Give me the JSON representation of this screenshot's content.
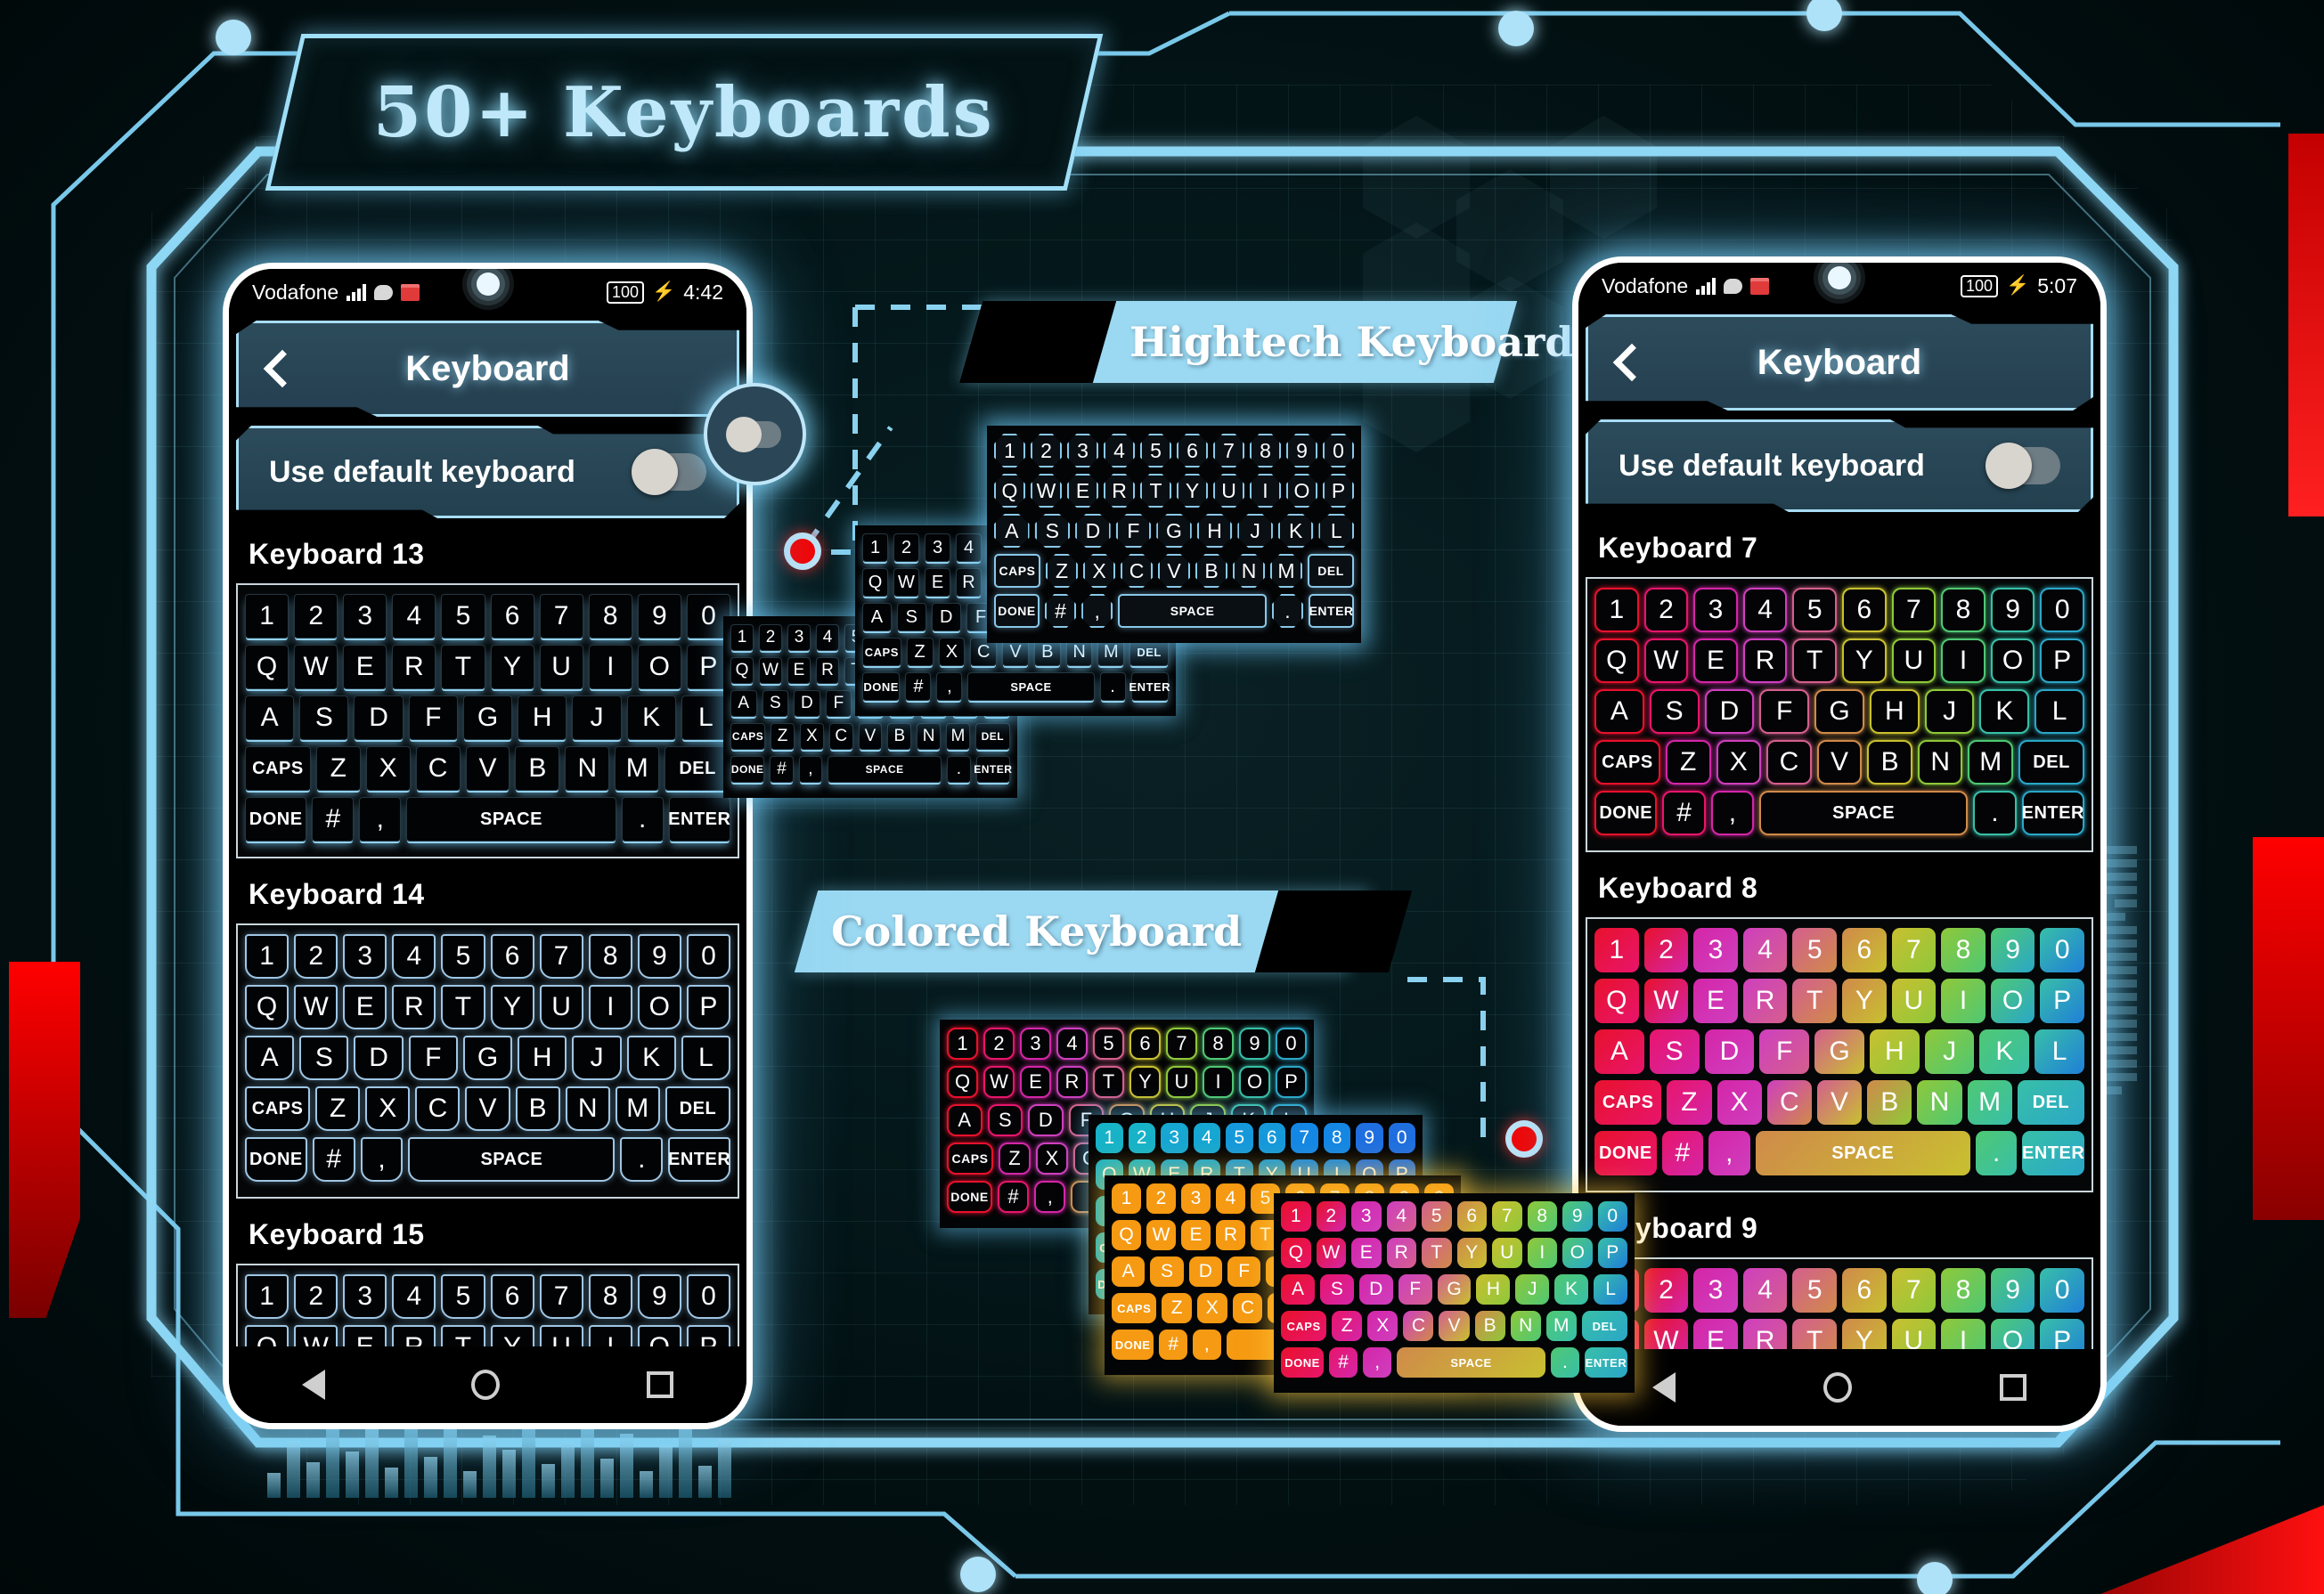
{
  "page": {
    "title": "50+ Keyboards",
    "accent": "#9bd9f2",
    "background": "#021012",
    "red_accent": "#e00000"
  },
  "banners": [
    {
      "id": "hightech",
      "label": "Hightech Keyboard"
    },
    {
      "id": "colored",
      "label": "Colored Keyboard"
    }
  ],
  "keyboard_rows": {
    "row1": [
      "1",
      "2",
      "3",
      "4",
      "5",
      "6",
      "7",
      "8",
      "9",
      "0"
    ],
    "row2": [
      "Q",
      "W",
      "E",
      "R",
      "T",
      "Y",
      "U",
      "I",
      "O",
      "P"
    ],
    "row3": [
      "A",
      "S",
      "D",
      "F",
      "G",
      "H",
      "J",
      "K",
      "L"
    ],
    "row4": [
      "CAPS",
      "Z",
      "X",
      "C",
      "V",
      "B",
      "N",
      "M",
      "DEL"
    ],
    "row5": [
      "DONE",
      "#",
      ",",
      "SPACE",
      ".",
      "ENTER"
    ]
  },
  "phone_left": {
    "status": {
      "carrier": "Vodafone",
      "signal_icon": "signal-bars-icon",
      "chat_icon": "chat-bubble-icon",
      "gift_icon": "gift-box-icon",
      "battery": "100",
      "charging_icon": "lightning-bolt-icon",
      "time": "4:42"
    },
    "header": {
      "back_icon": "back-chevron-icon",
      "title": "Keyboard"
    },
    "setting": {
      "label": "Use default keyboard",
      "toggle_state": "off"
    },
    "keyboards": [
      {
        "label": "Keyboard 13",
        "style": "black"
      },
      {
        "label": "Keyboard 14",
        "style": "outline"
      },
      {
        "label": "Keyboard 15",
        "style": "outline"
      }
    ],
    "nav": {
      "back": "nav-back-icon",
      "home": "nav-home-icon",
      "recents": "nav-recents-icon"
    }
  },
  "phone_right": {
    "status": {
      "carrier": "Vodafone",
      "signal_icon": "signal-bars-icon",
      "chat_icon": "chat-bubble-icon",
      "gift_icon": "gift-box-icon",
      "battery": "100",
      "charging_icon": "lightning-bolt-icon",
      "time": "5:07"
    },
    "header": {
      "back_icon": "back-chevron-icon",
      "title": "Keyboard"
    },
    "setting": {
      "label": "Use default keyboard",
      "toggle_state": "off"
    },
    "keyboards": [
      {
        "label": "Keyboard 7",
        "style": "rainbow-outline"
      },
      {
        "label": "Keyboard 8",
        "style": "rainbow-fill"
      },
      {
        "label": "Keyboard 9",
        "style": "rainbow-fill"
      }
    ],
    "nav": {
      "back": "nav-back-icon",
      "home": "nav-home-icon",
      "recents": "nav-recents-icon"
    }
  },
  "floating_keyboards": [
    {
      "id": "ht-octagon",
      "style": "octa",
      "group": "hightech"
    },
    {
      "id": "ht-black-a",
      "style": "black",
      "group": "hightech"
    },
    {
      "id": "ht-black-b",
      "style": "black",
      "group": "hightech"
    },
    {
      "id": "ht-black-c",
      "style": "black",
      "group": "hightech"
    },
    {
      "id": "cl-outline",
      "style": "rainbow-outline",
      "group": "colored"
    },
    {
      "id": "cl-blue",
      "style": "blue-fill",
      "group": "colored"
    },
    {
      "id": "cl-orange",
      "style": "orange-fill",
      "group": "colored"
    },
    {
      "id": "cl-rainbow",
      "style": "rainbow-fill",
      "group": "colored"
    }
  ],
  "rainbow_palette": [
    "#e8112d",
    "#e8156b",
    "#d426a8",
    "#cf3fbe",
    "#d45f8e",
    "#d08a4a",
    "#c8c030",
    "#8fc83a",
    "#4fc873",
    "#38bfa8",
    "#2aa7c8",
    "#1f7fd8"
  ],
  "connectors": [
    {
      "id": "hightech-dot",
      "color": "#f40000"
    },
    {
      "id": "colored-dot",
      "color": "#f40000"
    }
  ]
}
